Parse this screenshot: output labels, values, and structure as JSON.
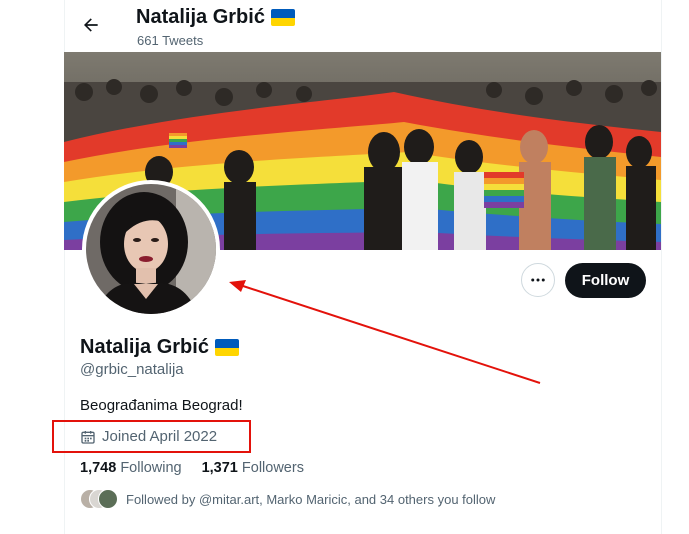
{
  "header": {
    "title": "Natalija Grbić",
    "tweet_count": "661 Tweets"
  },
  "profile": {
    "name": "Natalija Grbić",
    "handle": "@grbic_natalija",
    "bio": "Beograđanima Beograd!",
    "joined": "Joined April 2022",
    "flag_icon": "ukraine-flag-icon"
  },
  "stats": {
    "following_count": "1,748",
    "following_label": "Following",
    "followers_count": "1,371",
    "followers_label": "Followers"
  },
  "followed_by": "Followed by @mitar.art, Marko Maricic, and 34 others you follow",
  "actions": {
    "follow_label": "Follow",
    "more_icon": "more-horizontal-icon"
  },
  "colors": {
    "accent_dark": "#0f1419",
    "secondary_text": "#536471",
    "annotation_red": "#e3120b",
    "flag_blue": "#005bbb",
    "flag_yellow": "#ffd500"
  }
}
